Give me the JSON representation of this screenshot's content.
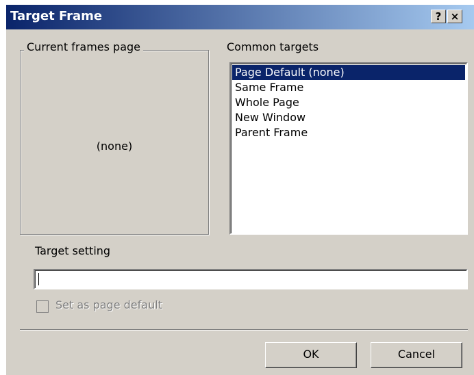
{
  "window": {
    "title": "Target Frame"
  },
  "titlebar": {
    "help_label": "?",
    "close_label": "×"
  },
  "current_frames": {
    "label": "Current frames page",
    "value": "(none)"
  },
  "common_targets": {
    "label": "Common targets",
    "items": [
      "Page Default (none)",
      "Same Frame",
      "Whole Page",
      "New Window",
      "Parent Frame"
    ],
    "selected": "Page Default (none)"
  },
  "target_setting": {
    "label": "Target setting",
    "value": ""
  },
  "page_default_checkbox": {
    "label": "Set as page default",
    "checked": false,
    "enabled": false
  },
  "buttons": {
    "ok_label": "OK",
    "cancel_label": "Cancel"
  },
  "colors": {
    "titlebar_start": "#0a246a",
    "titlebar_end": "#a6caf0",
    "face": "#d4d0c8",
    "selection": "#0a246a"
  }
}
